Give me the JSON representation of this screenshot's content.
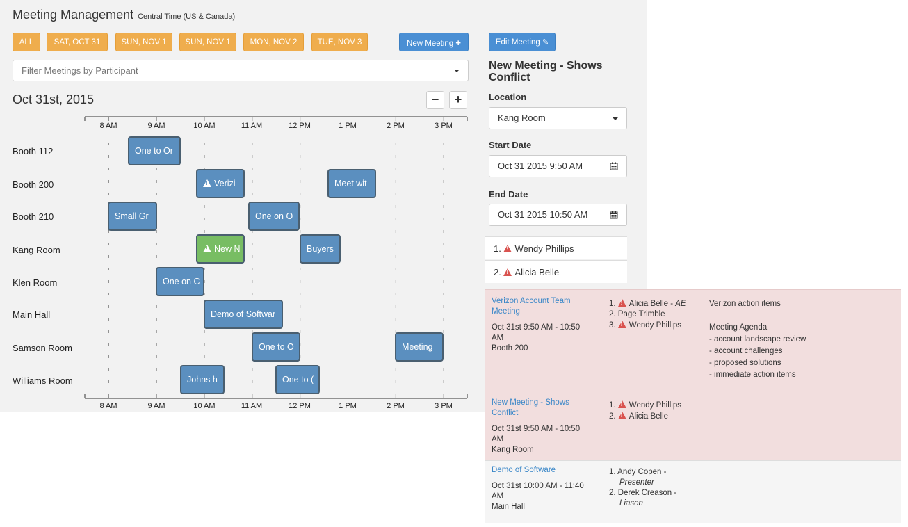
{
  "header": {
    "title": "Meeting Management",
    "timezone": "Central Time (US & Canada)"
  },
  "day_filters": [
    {
      "label": "ALL"
    },
    {
      "label": "SAT, OCT 31"
    },
    {
      "label": "SUN, NOV 1"
    },
    {
      "label": "SUN, NOV 1"
    },
    {
      "label": "MON, NOV 2"
    },
    {
      "label": "TUE, NOV 3"
    }
  ],
  "actions": {
    "new_meeting": "New Meeting",
    "new_meeting_icon": "plus-icon",
    "edit_meeting": "Edit Meeting",
    "edit_meeting_icon": "pencil-icon"
  },
  "filter": {
    "placeholder": "Filter Meetings by Participant"
  },
  "schedule": {
    "date": "Oct 31st, 2015",
    "zoom_out": "−",
    "zoom_in": "+",
    "time_ticks": [
      "8 AM",
      "9 AM",
      "10 AM",
      "11 AM",
      "12 PM",
      "1 PM",
      "2 PM",
      "3 PM"
    ],
    "rooms": [
      "Booth 112",
      "Booth 200",
      "Booth 210",
      "Kang Room",
      "Klen Room",
      "Main Hall",
      "Samson Room",
      "Williams Room"
    ],
    "events": [
      {
        "room": 0,
        "label": "One to Or",
        "conflict": false,
        "color": "blue"
      },
      {
        "room": 1,
        "label": "Verizi",
        "conflict": true,
        "color": "blue"
      },
      {
        "room": 1,
        "label": "Meet wit",
        "conflict": false,
        "color": "blue"
      },
      {
        "room": 2,
        "label": "Small Gr",
        "conflict": false,
        "color": "blue"
      },
      {
        "room": 2,
        "label": "One on O",
        "conflict": false,
        "color": "blue"
      },
      {
        "room": 3,
        "label": "New N",
        "conflict": true,
        "color": "green"
      },
      {
        "room": 3,
        "label": "Buyers",
        "conflict": false,
        "color": "blue"
      },
      {
        "room": 4,
        "label": "One on C",
        "conflict": false,
        "color": "blue"
      },
      {
        "room": 5,
        "label": "Demo of Softwar",
        "conflict": false,
        "color": "blue"
      },
      {
        "room": 6,
        "label": "One to O",
        "conflict": false,
        "color": "blue"
      },
      {
        "room": 6,
        "label": "Meeting",
        "conflict": false,
        "color": "blue"
      },
      {
        "room": 7,
        "label": "Johns h",
        "conflict": false,
        "color": "blue"
      },
      {
        "room": 7,
        "label": "One to (",
        "conflict": false,
        "color": "blue"
      }
    ]
  },
  "detail": {
    "title": "New Meeting - Shows Conflict",
    "location_label": "Location",
    "location_value": "Kang Room",
    "start_label": "Start Date",
    "start_value": "Oct 31 2015 9:50 AM",
    "end_label": "End Date",
    "end_value": "Oct 31 2015 10:50 AM",
    "calendar_icon": "calendar-icon",
    "participants": [
      "1.",
      "Wendy Phillips",
      "2.",
      "Alicia Belle"
    ]
  },
  "conflicts": [
    {
      "title": "Verizon Account Team Meeting",
      "time": "Oct 31st 9:50 AM - 10:50 AM",
      "room": "Booth 200",
      "participants": [
        {
          "num": "1.",
          "name": "Alicia Belle - ",
          "role": "AE",
          "warn": true
        },
        {
          "num": "2.",
          "name": "Page Trimble",
          "role": "",
          "warn": false
        },
        {
          "num": "3.",
          "name": "Wendy Phillips",
          "role": "",
          "warn": true
        }
      ],
      "notes": [
        "Verizon action items",
        "",
        "Meeting Agenda",
        "- account landscape review",
        "- account challenges",
        "- proposed solutions",
        "- immediate action items"
      ],
      "bg": "#f2dede"
    },
    {
      "title": "New Meeting - Shows Conflict",
      "time": "Oct 31st 9:50 AM - 10:50 AM",
      "room": "Kang Room",
      "participants": [
        {
          "num": "1.",
          "name": "Wendy Phillips",
          "role": "",
          "warn": true
        },
        {
          "num": "2.",
          "name": "Alicia Belle",
          "role": "",
          "warn": true
        }
      ],
      "notes": [],
      "bg": "#f2dede"
    },
    {
      "title": "Demo of Software",
      "time": "Oct 31st 10:00 AM - 11:40 AM",
      "room": "Main Hall",
      "participants": [
        {
          "num": "1.",
          "name": "Andy Copen - ",
          "role": "Presenter",
          "warn": false
        },
        {
          "num": "2.",
          "name": "Derek Creason - ",
          "role": "Liason",
          "warn": false
        }
      ],
      "notes": [],
      "bg": "#f5f5f5"
    }
  ]
}
